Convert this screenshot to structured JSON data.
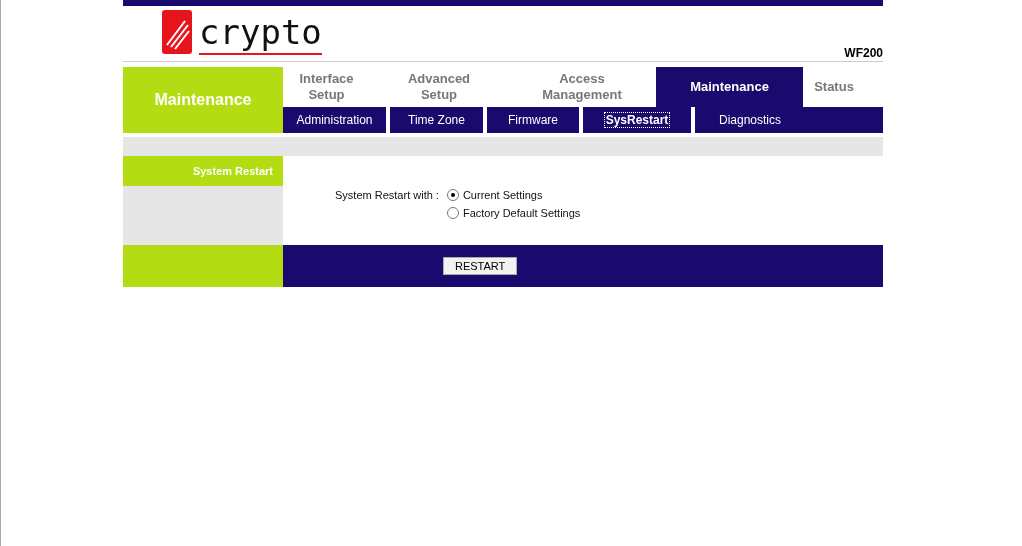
{
  "header": {
    "brand": "crypto",
    "model": "WF200"
  },
  "section_title": "Maintenance",
  "tabs": [
    {
      "label": "Interface Setup",
      "selected": false
    },
    {
      "label": "Advanced Setup",
      "selected": false
    },
    {
      "label": "Access Management",
      "selected": false
    },
    {
      "label": "Maintenance",
      "selected": true
    },
    {
      "label": "Status",
      "selected": false
    }
  ],
  "subtabs": [
    {
      "label": "Administration",
      "selected": false
    },
    {
      "label": "Time Zone",
      "selected": false
    },
    {
      "label": "Firmware",
      "selected": false
    },
    {
      "label": "SysRestart",
      "selected": true
    },
    {
      "label": "Diagnostics",
      "selected": false
    }
  ],
  "panel": {
    "title": "System Restart",
    "field_label": "System Restart with :",
    "options": [
      {
        "label": "Current Settings",
        "selected": true
      },
      {
        "label": "Factory Default Settings",
        "selected": false
      }
    ]
  },
  "button": "RESTART"
}
